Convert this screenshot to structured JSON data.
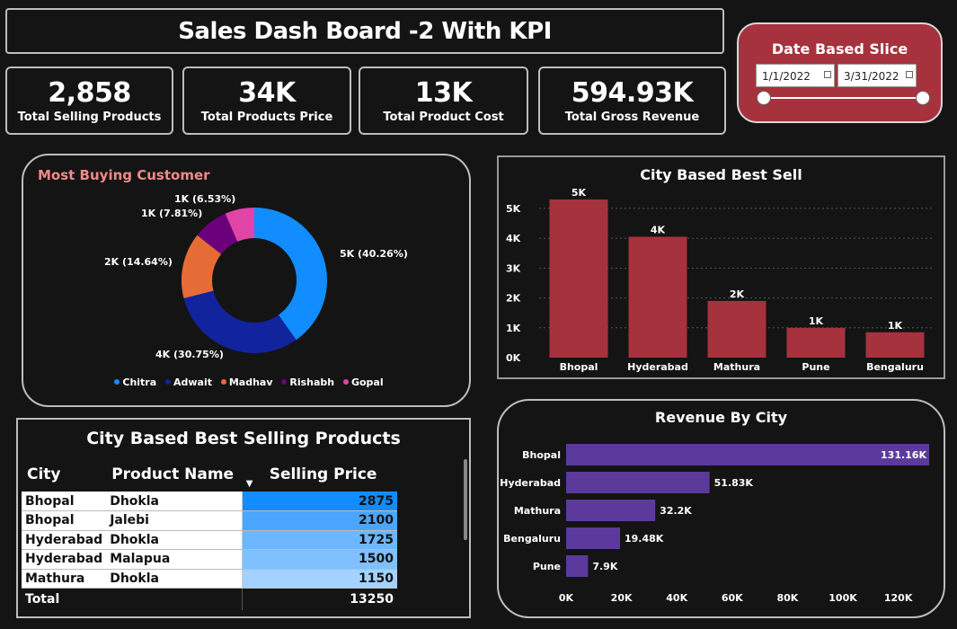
{
  "header": {
    "title": "Sales Dash Board -2  With KPI"
  },
  "kpis": [
    {
      "value": "2,858",
      "label": "Total Selling Products"
    },
    {
      "value": "34K",
      "label": "Total Products Price"
    },
    {
      "value": "13K",
      "label": "Total  Product Cost"
    },
    {
      "value": "594.93K",
      "label": "Total Gross Revenue"
    }
  ],
  "slicer": {
    "title": "Date Based Slice",
    "start": "1/1/2022",
    "end": "3/31/2022",
    "accent": "#a6323e"
  },
  "donut": {
    "title": "Most Buying Customer",
    "title_color": "#f08a8a",
    "legend": [
      "Chitra",
      "Adwait",
      "Madhav",
      "Rishabh",
      "Gopal"
    ]
  },
  "city_sales": {
    "title": "City Based Best Sell"
  },
  "revenue": {
    "title": "Revenue By City"
  },
  "table": {
    "title": "City Based Best Selling Products",
    "columns": [
      "City",
      "Product Name",
      "Selling Price"
    ],
    "rows": [
      {
        "city": "Bhopal",
        "product": "Dhokla",
        "price": "2875"
      },
      {
        "city": "Bhopal",
        "product": "Jalebi",
        "price": "2100"
      },
      {
        "city": "Hyderabad",
        "product": "Dhokla",
        "price": "1725"
      },
      {
        "city": "Hyderabad",
        "product": "Malapua",
        "price": "1500"
      },
      {
        "city": "Mathura",
        "product": "Dhokla",
        "price": "1150"
      }
    ],
    "total_label": "Total",
    "total_value": "13250"
  },
  "chart_data": [
    {
      "type": "pie",
      "title": "Most Buying Customer",
      "categories": [
        "Chitra",
        "Adwait",
        "Madhav",
        "Rishabh",
        "Gopal"
      ],
      "values": [
        40.26,
        30.75,
        14.64,
        7.81,
        6.53
      ],
      "labels": [
        "5K (40.26%)",
        "4K (30.75%)",
        "2K (14.64%)",
        "1K (7.81%)",
        "1K (6.53%)"
      ],
      "colors": [
        "#118dff",
        "#12239e",
        "#e66c37",
        "#6b007b",
        "#e044a7"
      ],
      "legend": "bottom"
    },
    {
      "type": "bar",
      "title": "City Based Best Sell",
      "categories": [
        "Bhopal",
        "Hyderabad",
        "Mathura",
        "Pune",
        "Bengaluru"
      ],
      "values": [
        5300,
        4050,
        1900,
        1000,
        850
      ],
      "data_labels": [
        "5K",
        "4K",
        "2K",
        "1K",
        "1K"
      ],
      "y_ticks": [
        "0K",
        "1K",
        "2K",
        "3K",
        "4K",
        "5K"
      ],
      "ylim": [
        0,
        5600
      ],
      "grid": true,
      "color": "#a6323e"
    },
    {
      "type": "bar",
      "orientation": "horizontal",
      "title": "Revenue By City",
      "categories": [
        "Bhopal",
        "Hyderabad",
        "Mathura",
        "Bengaluru",
        "Pune"
      ],
      "values": [
        131.16,
        51.83,
        32.2,
        19.48,
        7.9
      ],
      "data_labels": [
        "131.16K",
        "51.83K",
        "32.2K",
        "19.48K",
        "7.9K"
      ],
      "x_ticks": [
        "0K",
        "20K",
        "40K",
        "60K",
        "80K",
        "100K",
        "120K"
      ],
      "xlim": [
        0,
        131.16
      ],
      "color": "#5b3a9c"
    }
  ]
}
